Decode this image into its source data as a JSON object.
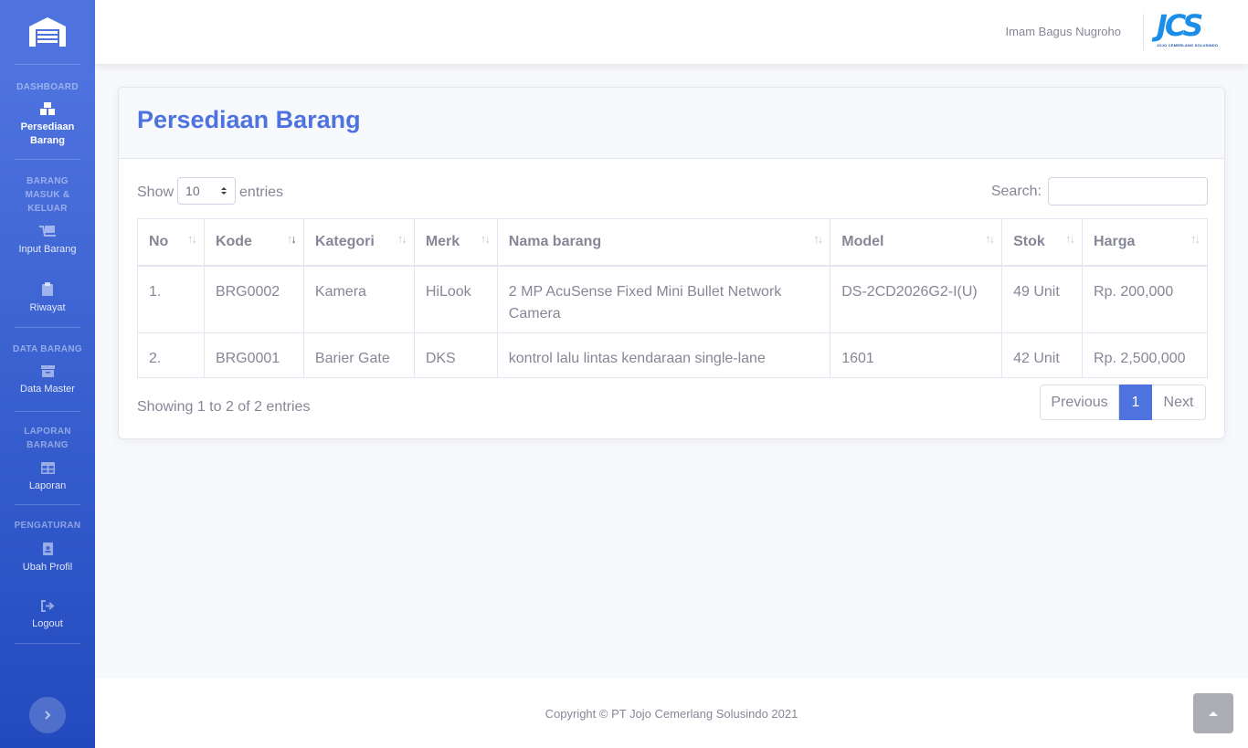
{
  "sidebar": {
    "sections": {
      "dashboard": "DASHBOARD",
      "barang_masuk_keluar": "BARANG MASUK & KELUAR",
      "data_barang": "DATA BARANG",
      "laporan_barang": "LAPORAN BARANG",
      "pengaturan": "PENGATURAN"
    },
    "items": [
      {
        "label": "Persediaan Barang",
        "icon": "boxes-icon"
      },
      {
        "label": "Input Barang",
        "icon": "dolly-icon"
      },
      {
        "label": "Riwayat",
        "icon": "clipboard-icon"
      },
      {
        "label": "Data Master",
        "icon": "archive-icon"
      },
      {
        "label": "Laporan",
        "icon": "table-icon"
      },
      {
        "label": "Ubah Profil",
        "icon": "id-badge-icon"
      },
      {
        "label": "Logout",
        "icon": "sign-out-icon"
      }
    ]
  },
  "topbar": {
    "user_name": "Imam Bagus Nugroho",
    "logo_text": "JCS",
    "logo_subtext": "JOJO CEMERLANG SOLUSINDO"
  },
  "card": {
    "title": "Persediaan Barang",
    "show_label": "Show",
    "entries_value": "10",
    "entries_label": "entries",
    "search_label": "Search:",
    "search_value": ""
  },
  "table": {
    "headers": [
      "No",
      "Kode",
      "Kategori",
      "Merk",
      "Nama barang",
      "Model",
      "Stok",
      "Harga"
    ],
    "rows": [
      {
        "no": "1.",
        "kode": "BRG0002",
        "kategori": "Kamera",
        "merk": "HiLook",
        "nama": "2 MP AcuSense Fixed Mini Bullet Network Camera",
        "model": "DS-2CD2026G2-I(U)",
        "stok": "49 Unit",
        "harga": "Rp. 200,000"
      },
      {
        "no": "2.",
        "kode": "BRG0001",
        "kategori": "Barier Gate",
        "merk": "DKS",
        "nama": "kontrol lalu lintas kendaraan single-lane",
        "model": "1601",
        "stok": "42 Unit",
        "harga": "Rp. 2,500,000"
      }
    ]
  },
  "pagination": {
    "info": "Showing 1 to 2 of 2 entries",
    "previous": "Previous",
    "current": "1",
    "next": "Next"
  },
  "footer": {
    "copyright": "Copyright © PT Jojo Cemerlang Solusindo 2021"
  },
  "colors": {
    "primary": "#4e73df",
    "sidebar_dark": "#224abe",
    "text": "#858796"
  }
}
